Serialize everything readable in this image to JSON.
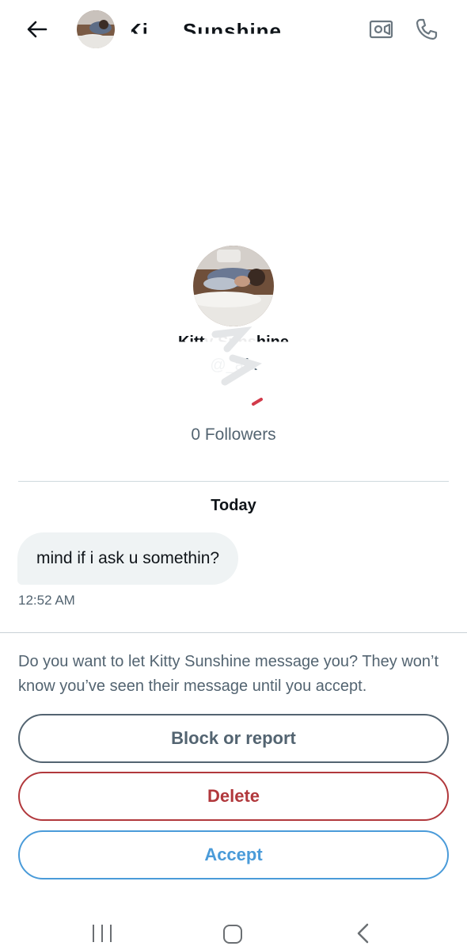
{
  "header": {
    "contact_name": "Kitty Sunshine",
    "back_icon": "arrow-left-icon",
    "video_icon": "video-call-icon",
    "call_icon": "phone-icon"
  },
  "profile": {
    "name": "Kitty Sunshine",
    "handle": "@_afa",
    "followers": "0 Followers"
  },
  "conversation": {
    "date_label": "Today",
    "messages": [
      {
        "text": "mind if i ask u somethin?",
        "time": "12:52 AM"
      }
    ]
  },
  "request": {
    "prompt": "Do you want to let Kitty Sunshine message you? They won’t know you’ve seen their message until you accept.",
    "block_label": "Block or report",
    "delete_label": "Delete",
    "accept_label": "Accept"
  },
  "colors": {
    "text_primary": "#0f1419",
    "text_secondary": "#536471",
    "delete": "#b1383c",
    "accept": "#4a9bd9",
    "bubble": "#eff3f4"
  },
  "navbar": {
    "recents_icon": "recents-icon",
    "home_icon": "home-icon",
    "back_icon": "nav-back-icon"
  }
}
